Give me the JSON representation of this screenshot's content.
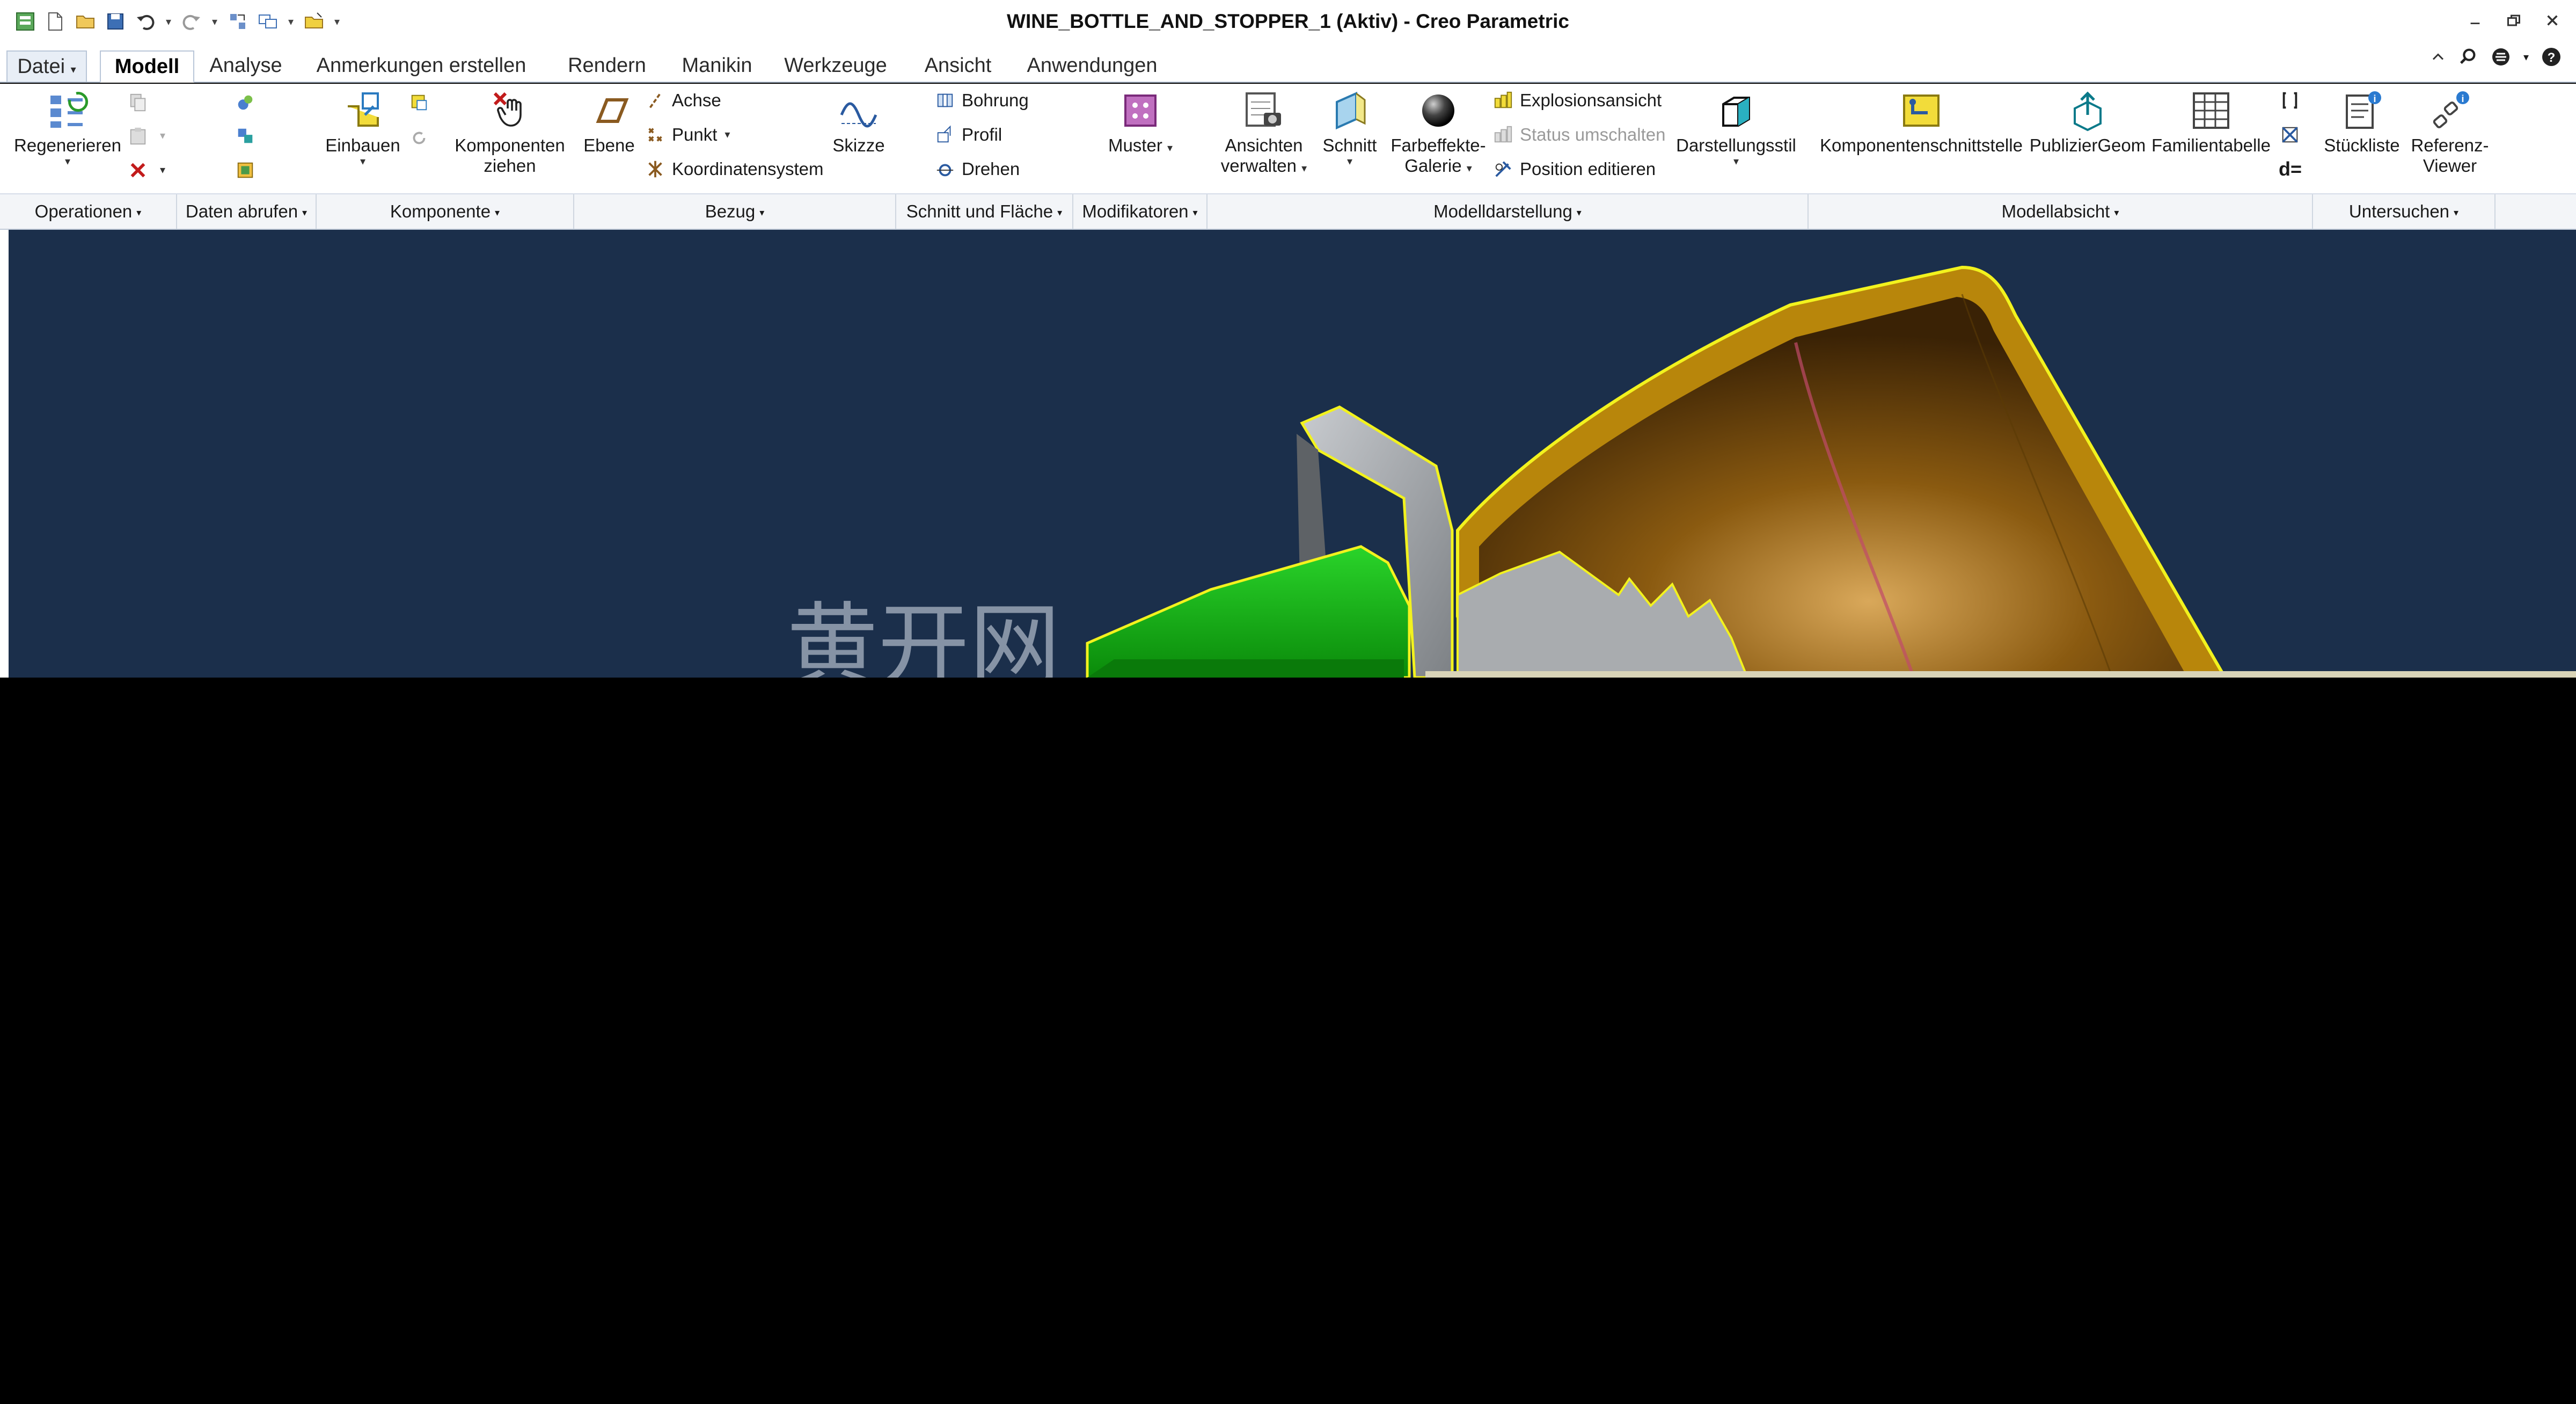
{
  "window": {
    "title": "WINE_BOTTLE_AND_STOPPER_1 (Aktiv) - Creo Parametric"
  },
  "quick_access": {
    "icons": [
      "app-icon",
      "new-icon",
      "open-icon",
      "save-icon",
      "undo-icon",
      "redo-icon",
      "regenerate-icon",
      "windows-icon",
      "close-window-icon",
      "customize-icon"
    ]
  },
  "tabs": [
    {
      "label": "Datei"
    },
    {
      "label": "Modell"
    },
    {
      "label": "Analyse"
    },
    {
      "label": "Anmerkungen erstellen"
    },
    {
      "label": "Rendern"
    },
    {
      "label": "Manikin"
    },
    {
      "label": "Werkzeuge"
    },
    {
      "label": "Ansicht"
    },
    {
      "label": "Anwendungen"
    }
  ],
  "active_tab": "Modell",
  "ribbon": {
    "operationen": {
      "regenerieren": "Regenerieren"
    },
    "komponente": {
      "einbauen": "Einbauen",
      "komponenten_ziehen_1": "Komponenten",
      "komponenten_ziehen_2": "ziehen"
    },
    "bezug": {
      "ebene": "Ebene",
      "achse": "Achse",
      "punkt": "Punkt",
      "koordinatensystem": "Koordinatensystem",
      "skizze": "Skizze"
    },
    "schnitt_flaeche": {
      "bohrung": "Bohrung",
      "profil": "Profil",
      "drehen": "Drehen"
    },
    "modifikatoren": {
      "muster": "Muster"
    },
    "modelldarstellung": {
      "ansichten_1": "Ansichten",
      "ansichten_2": "verwalten",
      "schnitt": "Schnitt",
      "farbeffekte_1": "Farbeffekte-",
      "farbeffekte_2": "Galerie",
      "explosionsansicht": "Explosionsansicht",
      "status_umschalten": "Status umschalten",
      "position_editieren": "Position editieren",
      "darstellungsstil": "Darstellungsstil"
    },
    "modellabsicht": {
      "komponentenschnittstelle": "Komponentenschnittstelle",
      "publiziergeom": "PublizierGeom",
      "familientabelle": "Familientabelle",
      "d_equals": "d="
    },
    "untersuchen": {
      "stueckliste": "Stückliste",
      "referenz_1": "Referenz-",
      "referenz_2": "Viewer"
    }
  },
  "groups": [
    {
      "label": "Operationen"
    },
    {
      "label": "Daten abrufen"
    },
    {
      "label": "Komponente"
    },
    {
      "label": "Bezug"
    },
    {
      "label": "Schnitt und Fläche"
    },
    {
      "label": "Modifikatoren"
    },
    {
      "label": "Modelldarstellung"
    },
    {
      "label": "Modellabsicht"
    },
    {
      "label": "Untersuchen"
    }
  ],
  "viewport": {
    "background_color": "#1b2f4b",
    "watermark": "黄开网"
  },
  "colors": {
    "accent_tab_border": "#b9c6d8",
    "stopper_green": "#1fae1f",
    "bottle_bronze": "#8a5a10",
    "highlight_yellow": "#f2f21e",
    "metal_grey": "#a9acaf"
  }
}
